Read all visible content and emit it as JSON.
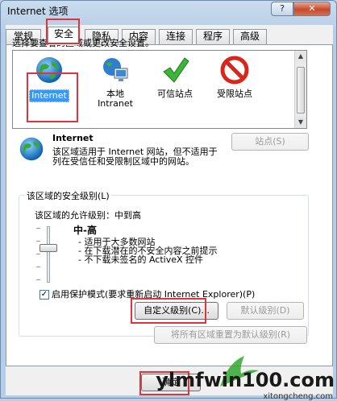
{
  "window": {
    "title": "Internet 选项",
    "help_glyph": "?",
    "close_glyph": "✕"
  },
  "tabs": [
    {
      "label": "常规"
    },
    {
      "label": "安全"
    },
    {
      "label": "隐私"
    },
    {
      "label": "内容"
    },
    {
      "label": "连接"
    },
    {
      "label": "程序"
    },
    {
      "label": "高级"
    }
  ],
  "active_tab": "安全",
  "security": {
    "instruction": "选择要查看的区域或更改安全设置。",
    "zones": [
      {
        "label": "Internet",
        "icon": "globe-icon",
        "selected": true
      },
      {
        "label": "本地\nIntranet",
        "icon": "intranet-icon",
        "selected": false
      },
      {
        "label": "可信站点",
        "icon": "checkmark-icon",
        "selected": false
      },
      {
        "label": "受限站点",
        "icon": "no-entry-icon",
        "selected": false
      }
    ],
    "selected_zone": {
      "name": "Internet",
      "description": "该区域适用于 Internet 网站，但不适用于列在受信任和受限制区域中的网站。",
      "sites_button": "站点(S)"
    },
    "level_group": {
      "title": "该区域的安全级别(L)",
      "allowed": "该区域的允许级别：中到高",
      "level_name": "中-高",
      "level_items": [
        "- 适用于大多数网站",
        "- 在下载潜在的不安全内容之前提示",
        "- 不下载未签名的 ActiveX 控件"
      ],
      "level_fraction": 0.5,
      "protected_mode_label": "启用保护模式(要求重新启动 Internet Explorer)(P)",
      "protected_mode_checked": true,
      "custom_button": "自定义级别(C)...",
      "default_button": "默认级别(D)",
      "reset_button": "将所有区域重置为默认级别(R)"
    }
  },
  "footer": {
    "ok_button": "确定"
  },
  "watermark": {
    "main": "ylmfwin100.com",
    "sub": "xitongcheng.com"
  },
  "colors": {
    "highlight_box": "#e0343a",
    "selection": "#3399ff"
  }
}
